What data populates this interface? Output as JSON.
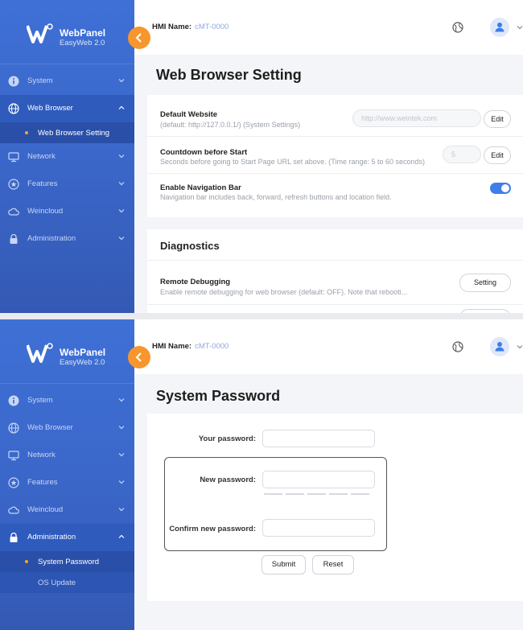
{
  "brand": {
    "name": "WebPanel",
    "subtitle": "EasyWeb 2.0"
  },
  "header": {
    "hmi_label": "HMI Name:",
    "hmi_value": "cMT-0000"
  },
  "sidebar_top": {
    "items": [
      {
        "label": "System"
      },
      {
        "label": "Web Browser"
      },
      {
        "label": "Web Browser Setting"
      },
      {
        "label": "Network"
      },
      {
        "label": "Features"
      },
      {
        "label": "Weincloud"
      },
      {
        "label": "Administration"
      }
    ]
  },
  "sidebar_bottom": {
    "items": [
      {
        "label": "System"
      },
      {
        "label": "Web Browser"
      },
      {
        "label": "Network"
      },
      {
        "label": "Features"
      },
      {
        "label": "Weincloud"
      },
      {
        "label": "Administration"
      },
      {
        "label": "System Password"
      },
      {
        "label": "OS Update"
      }
    ]
  },
  "web_browser_setting": {
    "title": "Web Browser Setting",
    "default_website": {
      "title": "Default Website",
      "desc": "(default: http://127.0.0.1/) (System Settings)",
      "value": "http://www.weintek.com",
      "button": "Edit"
    },
    "countdown": {
      "title": "Countdown before Start",
      "desc": "Seconds before going to Start Page URL set above. (Time range: 5 to 60 seconds)",
      "value": "5",
      "button": "Edit"
    },
    "nav_bar": {
      "title": "Enable Navigation Bar",
      "desc": "Navigation bar includes back, forward, refresh buttons and location field.",
      "enabled": true
    }
  },
  "diagnostics": {
    "title": "Diagnostics",
    "remote_debugging": {
      "title": "Remote Debugging",
      "desc": "Enable remote debugging for web browser (default: OFF). Note that rebooti...",
      "button": "Setting"
    }
  },
  "system_password": {
    "title": "System Password",
    "your_password_label": "Your password:",
    "new_password_label": "New password:",
    "confirm_password_label": "Confirm new password:",
    "submit": "Submit",
    "reset": "Reset"
  },
  "colors": {
    "accent": "#3f7de8",
    "sidebar": "#3a66c8",
    "collapse": "#f7962c",
    "bullet": "#f5a623"
  }
}
